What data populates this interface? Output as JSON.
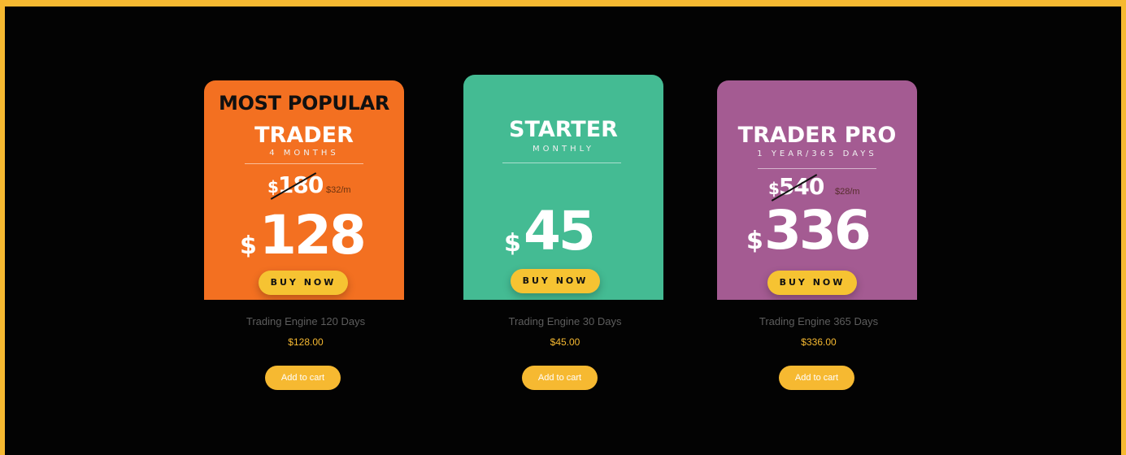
{
  "products": [
    {
      "card": {
        "headline": "MOST POPULAR",
        "plan": "TRADER",
        "term": "4 MONTHS",
        "old_price_symbol": "$",
        "old_price": "180",
        "per_month": "$32/m",
        "price_symbol": "$",
        "price": "128",
        "button": "BUY NOW",
        "color": "#f37021"
      },
      "title": "Trading Engine 120 Days",
      "price": "$128.00",
      "cart_button": "Add to cart"
    },
    {
      "card": {
        "headline": "",
        "plan": "STARTER",
        "term": "MONTHLY",
        "price_symbol": "$",
        "price": "45",
        "button": "BUY NOW",
        "color": "#44bb93"
      },
      "title": "Trading Engine 30 Days",
      "price": "$45.00",
      "cart_button": "Add to cart"
    },
    {
      "card": {
        "headline": "",
        "plan": "TRADER PRO",
        "term": "1 YEAR/365 DAYS",
        "old_price_symbol": "$",
        "old_price": "540",
        "per_month": "$28/m",
        "price_symbol": "$",
        "price": "336",
        "button": "BUY NOW",
        "color": "#a45b92"
      },
      "title": "Trading Engine 365 Days",
      "price": "$336.00",
      "cart_button": "Add to cart"
    }
  ],
  "colors": {
    "frame": "#f6b931",
    "background": "#030303",
    "accent": "#f6b931"
  }
}
